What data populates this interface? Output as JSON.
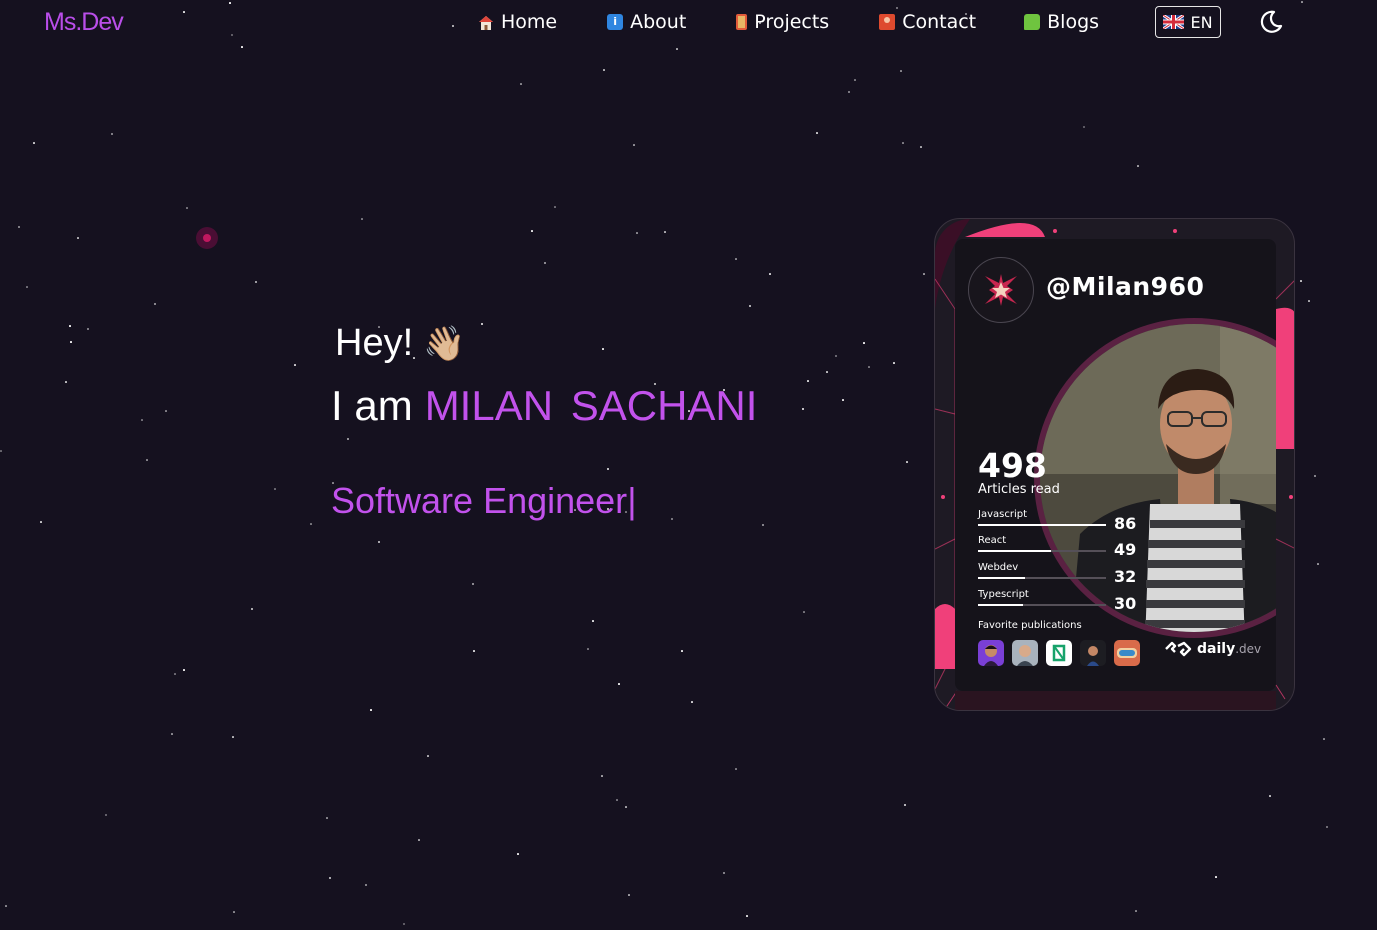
{
  "header": {
    "logo": "Ms.Dev",
    "nav": [
      {
        "label": "Home",
        "icon": "house-icon"
      },
      {
        "label": "About",
        "icon": "info-icon"
      },
      {
        "label": "Projects",
        "icon": "mobile-phone-icon"
      },
      {
        "label": "Contact",
        "icon": "contact-book-icon"
      },
      {
        "label": "Blogs",
        "icon": "speech-bubble-icon"
      }
    ],
    "language": {
      "label": "EN",
      "icon": "uk-flag-icon"
    },
    "theme_toggle": {
      "icon": "moon-icon"
    }
  },
  "hero": {
    "greeting": "Hey!",
    "wave_emoji": "👋🏼",
    "intro": "I am",
    "name": "MILAN SACHANI",
    "role": "Software Engineer",
    "cursor": "|"
  },
  "devcard": {
    "handle": "@Milan960",
    "articles_read": "498",
    "articles_read_label": "Articles read",
    "tags": [
      {
        "name": "Javascript",
        "count": "86",
        "fill": 1.0
      },
      {
        "name": "React",
        "count": "49",
        "fill": 0.57
      },
      {
        "name": "Webdev",
        "count": "32",
        "fill": 0.37
      },
      {
        "name": "Typescript",
        "count": "30",
        "fill": 0.35
      }
    ],
    "favorites_label": "Favorite publications",
    "brand": "daily",
    "brand_suffix": ".dev"
  },
  "colors": {
    "background": "#15111f",
    "accent": "#c252ec",
    "logo": "#b94ee9",
    "card_accent": "#f0407a"
  }
}
